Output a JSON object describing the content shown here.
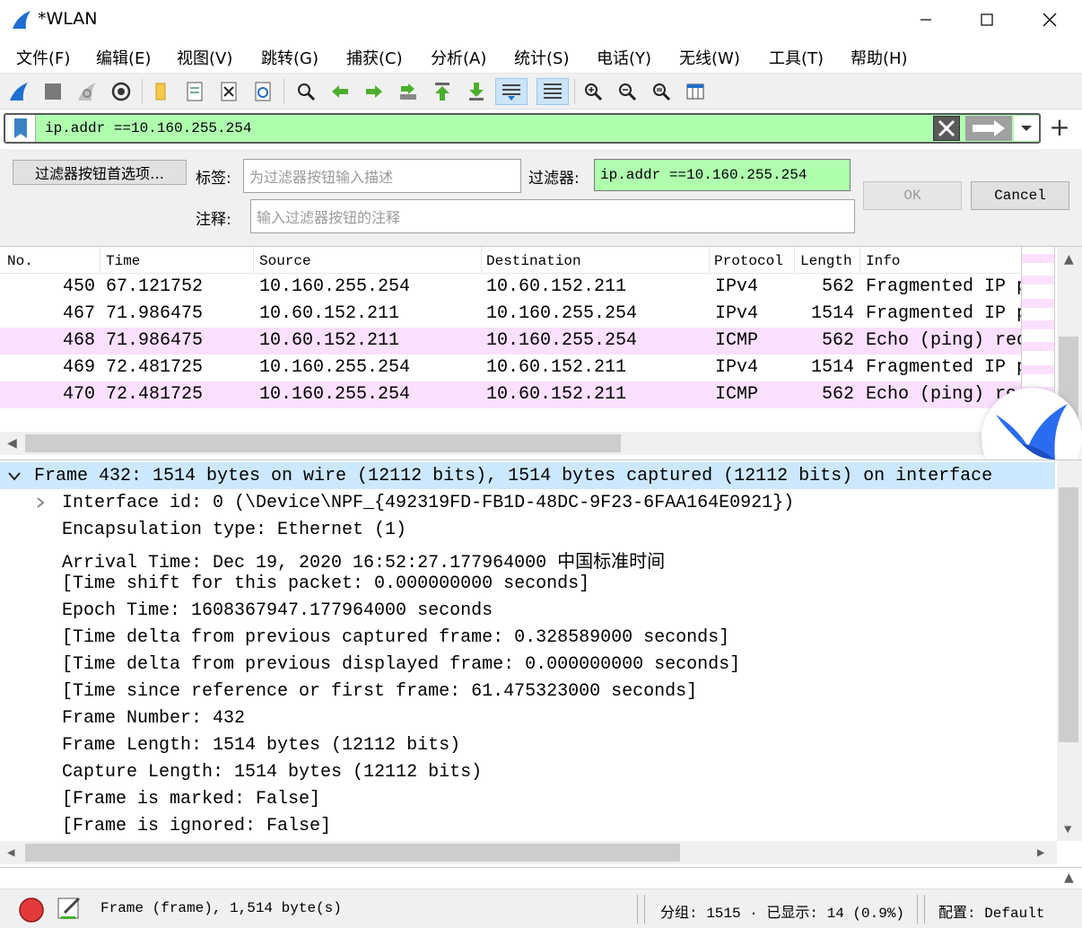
{
  "window": {
    "title": "*WLAN"
  },
  "menu": [
    "文件(F)",
    "编辑(E)",
    "视图(V)",
    "跳转(G)",
    "捕获(C)",
    "分析(A)",
    "统计(S)",
    "电话(Y)",
    "无线(W)",
    "工具(T)",
    "帮助(H)"
  ],
  "filter": {
    "value": "ip.addr ==10.160.255.254"
  },
  "prefs": {
    "prefs_button": "过滤器按钮首选项…",
    "label_label": "标签:",
    "label_placeholder": "为过滤器按钮输入描述",
    "filter_label": "过滤器:",
    "filter_value": "ip.addr ==10.160.255.254",
    "comment_label": "注释:",
    "comment_placeholder": "输入过滤器按钮的注释",
    "ok": "OK",
    "cancel": "Cancel"
  },
  "packet_list": {
    "columns": [
      "No.",
      "Time",
      "Source",
      "Destination",
      "Protocol",
      "Length",
      "Info"
    ],
    "rows": [
      {
        "no": "450",
        "time": "67.121752",
        "src": "10.160.255.254",
        "dst": "10.60.152.211",
        "proto": "IPv4",
        "len": "562",
        "info": "Fragmented IP p"
      },
      {
        "no": "467",
        "time": "71.986475",
        "src": "10.60.152.211",
        "dst": "10.160.255.254",
        "proto": "IPv4",
        "len": "1514",
        "info": "Fragmented IP p"
      },
      {
        "no": "468",
        "time": "71.986475",
        "src": "10.60.152.211",
        "dst": "10.160.255.254",
        "proto": "ICMP",
        "len": "562",
        "info": "Echo (ping) req"
      },
      {
        "no": "469",
        "time": "72.481725",
        "src": "10.160.255.254",
        "dst": "10.60.152.211",
        "proto": "IPv4",
        "len": "1514",
        "info": "Fragmented IP p"
      },
      {
        "no": "470",
        "time": "72.481725",
        "src": "10.160.255.254",
        "dst": "10.60.152.211",
        "proto": "ICMP",
        "len": "562",
        "info": "Echo (ping) re"
      }
    ]
  },
  "details": [
    "Frame 432: 1514 bytes on wire (12112 bits), 1514 bytes captured (12112 bits) on interface",
    "Interface id: 0 (\\Device\\NPF_{492319FD-FB1D-48DC-9F23-6FAA164E0921})",
    "Encapsulation type: Ethernet (1)",
    "Arrival Time: Dec 19, 2020 16:52:27.177964000 中国标准时间",
    "[Time shift for this packet: 0.000000000 seconds]",
    "Epoch Time: 1608367947.177964000 seconds",
    "[Time delta from previous captured frame: 0.328589000 seconds]",
    "[Time delta from previous displayed frame: 0.000000000 seconds]",
    "[Time since reference or first frame: 61.475323000 seconds]",
    "Frame Number: 432",
    "Frame Length: 1514 bytes (12112 bits)",
    "Capture Length: 1514 bytes (12112 bits)",
    "[Frame is marked: False]",
    "[Frame is ignored: False]"
  ],
  "status": {
    "frame": "Frame (frame), 1,514 byte(s)",
    "packets": "分组: 1515 · 已显示: 14 (0.9%)",
    "profile": "配置: Default"
  },
  "colors": {
    "filter_valid": "#afffaf",
    "icmp_row": "#fce0ff",
    "selected": "#cce8ff",
    "accent": "#1e6fd0"
  }
}
